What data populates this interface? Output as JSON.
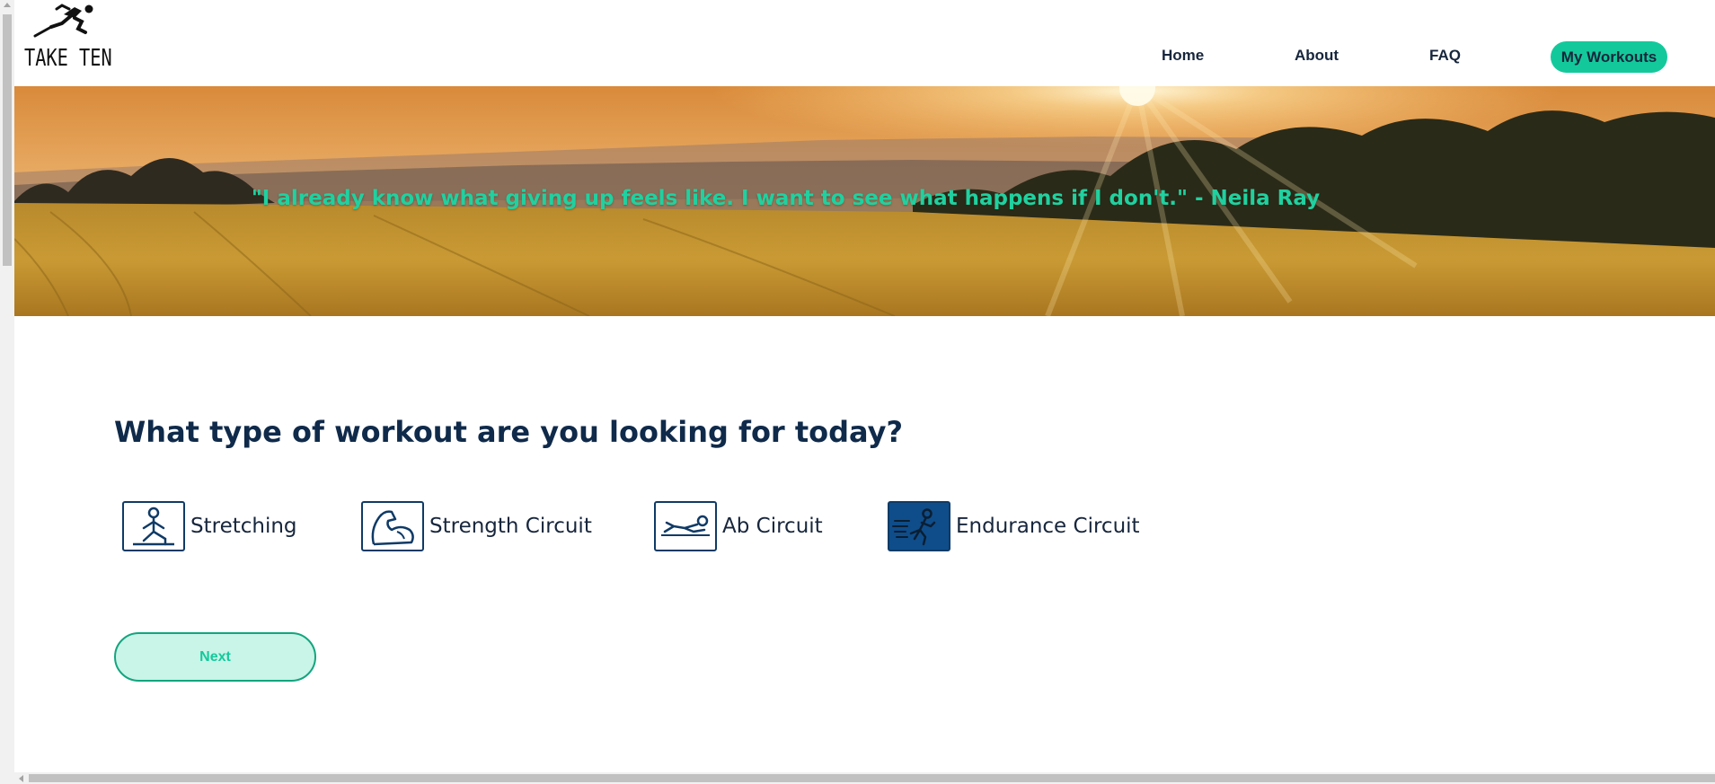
{
  "header": {
    "logo_text": "TAKE TEN",
    "nav": {
      "home": "Home",
      "about": "About",
      "faq": "FAQ",
      "my_workouts": "My Workouts"
    }
  },
  "hero": {
    "quote": "\"I already know what giving up feels like. I want to see what happens if I don't.\" - Neila Ray"
  },
  "main": {
    "question": "What type of workout are you looking for today?",
    "options": [
      {
        "label": "Stretching",
        "icon": "stretching-icon",
        "selected": false
      },
      {
        "label": "Strength Circuit",
        "icon": "flexed-bicep-icon",
        "selected": false
      },
      {
        "label": "Ab Circuit",
        "icon": "situp-icon",
        "selected": false
      },
      {
        "label": "Endurance Circuit",
        "icon": "running-person-icon",
        "selected": true
      }
    ],
    "next_label": "Next"
  },
  "colors": {
    "accent": "#13c99b",
    "navy": "#0f2a4a",
    "selected_tile": "#0f4d8a",
    "next_bg": "#c9f4e8"
  }
}
